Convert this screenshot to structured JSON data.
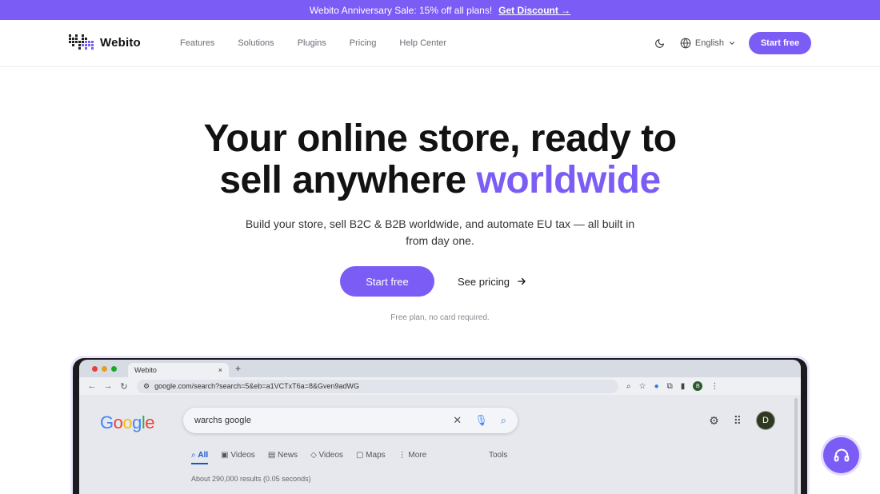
{
  "promo": {
    "text": "Webito Anniversary Sale: 15% off all plans!",
    "link_label": "Get Discount →"
  },
  "brand": {
    "name": "Webito"
  },
  "nav": {
    "links": [
      "Features",
      "Solutions",
      "Plugins",
      "Pricing",
      "Help Center"
    ],
    "language": "English",
    "start_label": "Start free"
  },
  "hero": {
    "title_part1": "Your online store, ready to",
    "title_part2": "sell anywhere",
    "title_accent": "worldwide",
    "subtitle": "Build your store, sell B2C & B2B worldwide, and automate EU tax — all built in from day one.",
    "primary_cta": "Start free",
    "secondary_cta": "See pricing",
    "note": "Free plan, no card required."
  },
  "screenshot": {
    "tab_title": "Webito",
    "tab_close": "×",
    "tab_new": "+",
    "url": "google.com/search?search=5&eb=a1VCTxT6a=8&Gven9adWG",
    "google_logo": "Google",
    "query": "warchs google",
    "avatar_letter": "D",
    "mini_avatar_letter": "B",
    "tabs": [
      "All",
      "Videos",
      "News",
      "Videos",
      "Maps",
      "More"
    ],
    "tools_label": "Tools",
    "results": "About 290,000 results (0.05 seconds)"
  },
  "colors": {
    "accent": "#7b5cf5",
    "promo_bg": "#7b5cf5",
    "support_bg": "#7b5cf5"
  },
  "icons": {
    "theme_toggle": "moon-icon",
    "language": "globe-icon",
    "support": "headset-icon",
    "arrow": "arrow-right-icon"
  }
}
